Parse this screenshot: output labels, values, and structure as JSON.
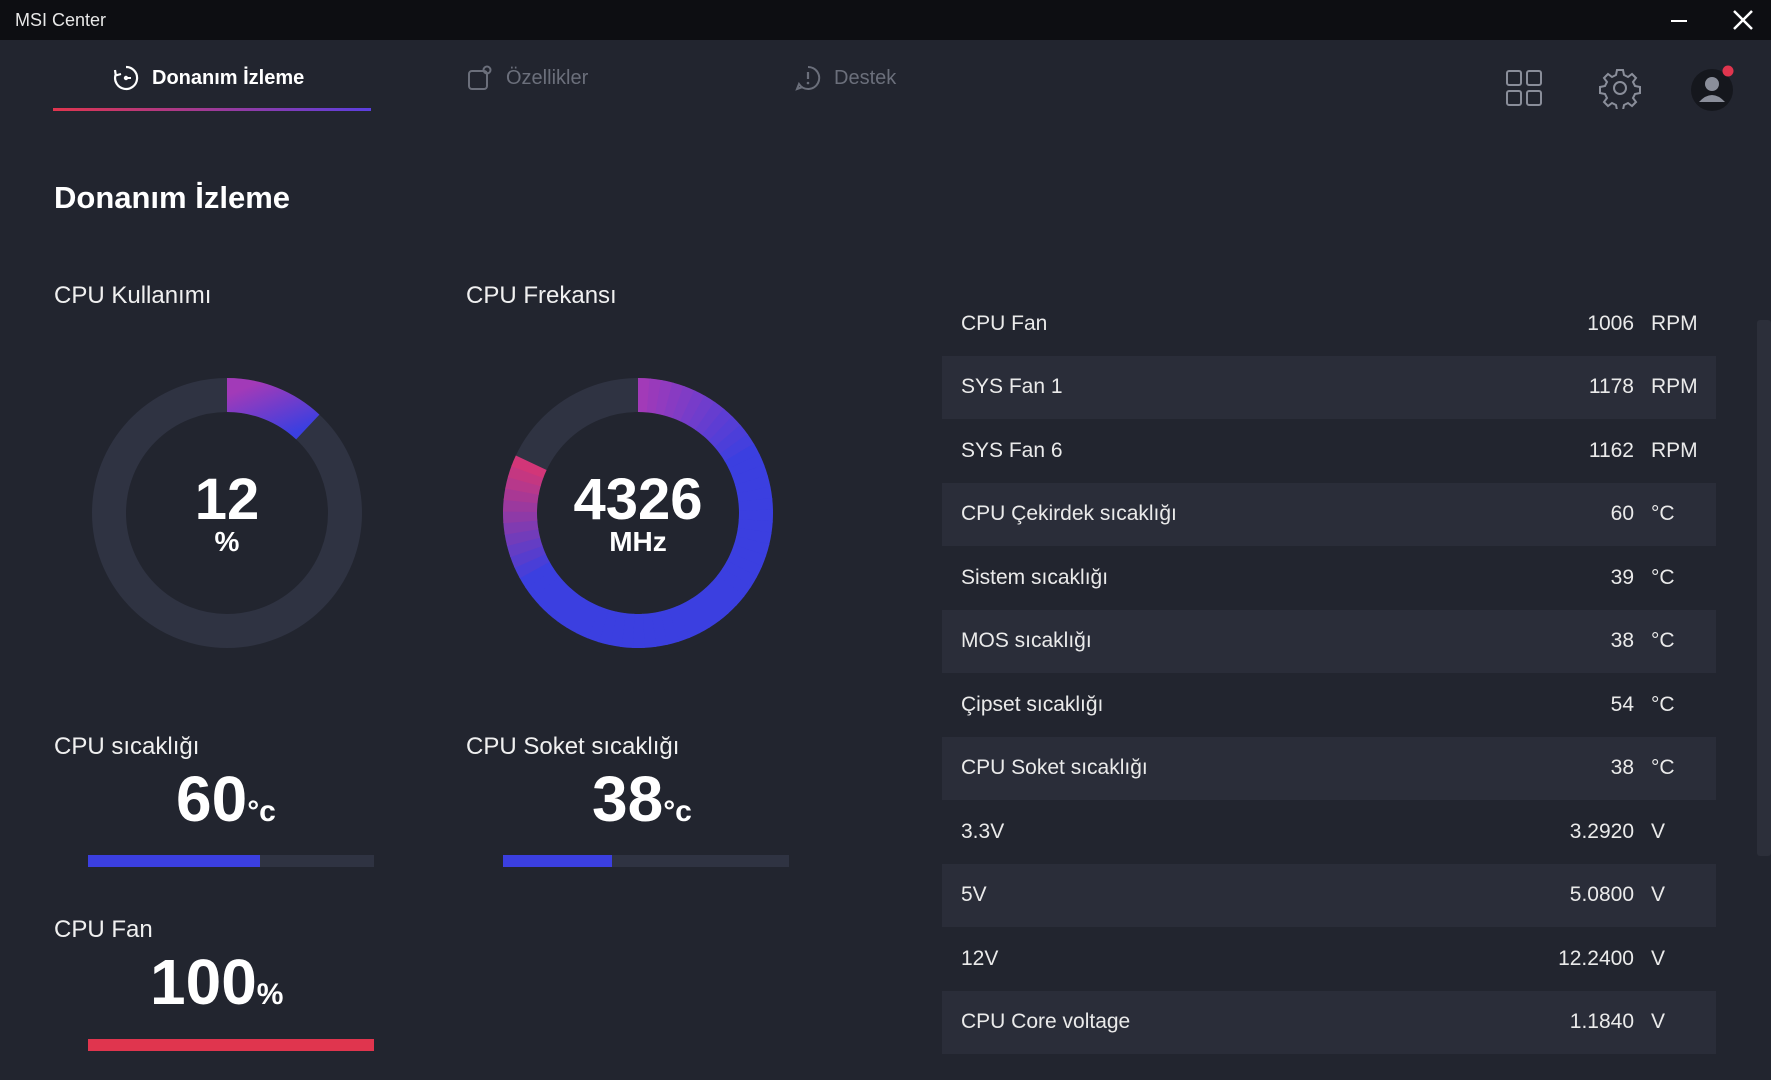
{
  "window": {
    "title": "MSI Center"
  },
  "tabs": [
    {
      "label": "Donanım İzleme",
      "active": true,
      "icon": "monitor-refresh-icon"
    },
    {
      "label": "Özellikler",
      "active": false,
      "icon": "features-icon"
    },
    {
      "label": "Destek",
      "active": false,
      "icon": "support-icon"
    }
  ],
  "header_icons": [
    "grid-view-icon",
    "settings-gear-icon",
    "user-avatar-icon"
  ],
  "page": {
    "title": "Donanım İzleme"
  },
  "cpu_usage": {
    "label": "CPU Kullanımı",
    "value": "12",
    "unit": "%",
    "fraction": 0.12
  },
  "cpu_freq": {
    "label": "CPU Frekansı",
    "value": "4326",
    "unit": "MHz",
    "fraction": 0.82
  },
  "cpu_temp": {
    "label": "CPU sıcaklığı",
    "value": "60",
    "unit": "°c",
    "fraction": 0.6
  },
  "socket_temp": {
    "label": "CPU Soket sıcaklığı",
    "value": "38",
    "unit": "°c",
    "fraction": 0.38
  },
  "cpu_fan": {
    "label": "CPU Fan",
    "value": "100",
    "unit": "%",
    "fraction": 1.0
  },
  "sensors": [
    {
      "name": "CPU Fan",
      "value": "1006",
      "unit": "RPM"
    },
    {
      "name": "SYS Fan 1",
      "value": "1178",
      "unit": "RPM"
    },
    {
      "name": "SYS Fan 6",
      "value": "1162",
      "unit": "RPM"
    },
    {
      "name": "CPU Çekirdek sıcaklığı",
      "value": "60",
      "unit": "°C"
    },
    {
      "name": "Sistem sıcaklığı",
      "value": "39",
      "unit": "°C"
    },
    {
      "name": "MOS sıcaklığı",
      "value": "38",
      "unit": "°C"
    },
    {
      "name": "Çipset sıcaklığı",
      "value": "54",
      "unit": "°C"
    },
    {
      "name": "CPU Soket sıcaklığı",
      "value": "38",
      "unit": "°C"
    },
    {
      "name": "3.3V",
      "value": "3.2920",
      "unit": "V"
    },
    {
      "name": "5V",
      "value": "5.0800",
      "unit": "V"
    },
    {
      "name": "12V",
      "value": "12.2400",
      "unit": "V"
    },
    {
      "name": "CPU Core voltage",
      "value": "1.1840",
      "unit": "V"
    }
  ],
  "colors": {
    "background": "#22252f",
    "accent_blue": "#3b3fe0",
    "accent_red": "#e0354e",
    "accent_magenta": "#a23ab8"
  }
}
